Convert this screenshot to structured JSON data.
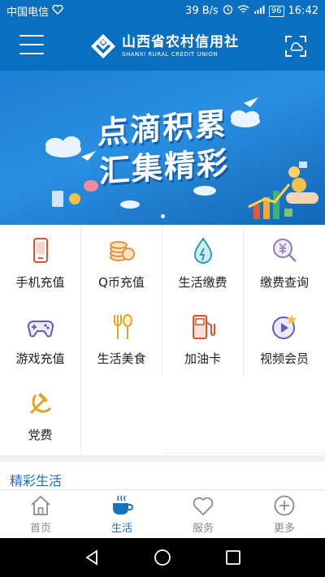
{
  "status": {
    "carrier": "中国电信",
    "speed": "39 B/s",
    "battery": "96",
    "time": "16:42"
  },
  "header": {
    "title": "山西省农村信用社",
    "subtitle": "SHANXI RURAL CREDIT UNION"
  },
  "banner": {
    "line1": "点滴积累",
    "line2": "汇集精彩"
  },
  "services": [
    {
      "label": "手机充值",
      "icon": "phone-icon"
    },
    {
      "label": "Q币充值",
      "icon": "coins-icon"
    },
    {
      "label": "生活缴费",
      "icon": "water-drop-icon"
    },
    {
      "label": "缴费查询",
      "icon": "search-yuan-icon"
    },
    {
      "label": "游戏充值",
      "icon": "gamepad-icon"
    },
    {
      "label": "生活美食",
      "icon": "fork-spoon-icon"
    },
    {
      "label": "加油卡",
      "icon": "fuel-pump-icon"
    },
    {
      "label": "视频会员",
      "icon": "play-icon"
    },
    {
      "label": "党费",
      "icon": "party-emblem-icon"
    }
  ],
  "section": {
    "title": "精彩生活"
  },
  "tabs": [
    {
      "label": "首页",
      "icon": "home-icon"
    },
    {
      "label": "生活",
      "icon": "coffee-cup-icon",
      "active": true
    },
    {
      "label": "服务",
      "icon": "heart-icon"
    },
    {
      "label": "更多",
      "icon": "plus-circle-icon"
    }
  ],
  "colors": {
    "primary": "#0a6fbf",
    "accent": "#1a6fc0",
    "icon_red": "#d9552f",
    "icon_orange": "#e38a2c",
    "icon_teal": "#2a9ea2",
    "icon_purple": "#6b5bb0"
  }
}
